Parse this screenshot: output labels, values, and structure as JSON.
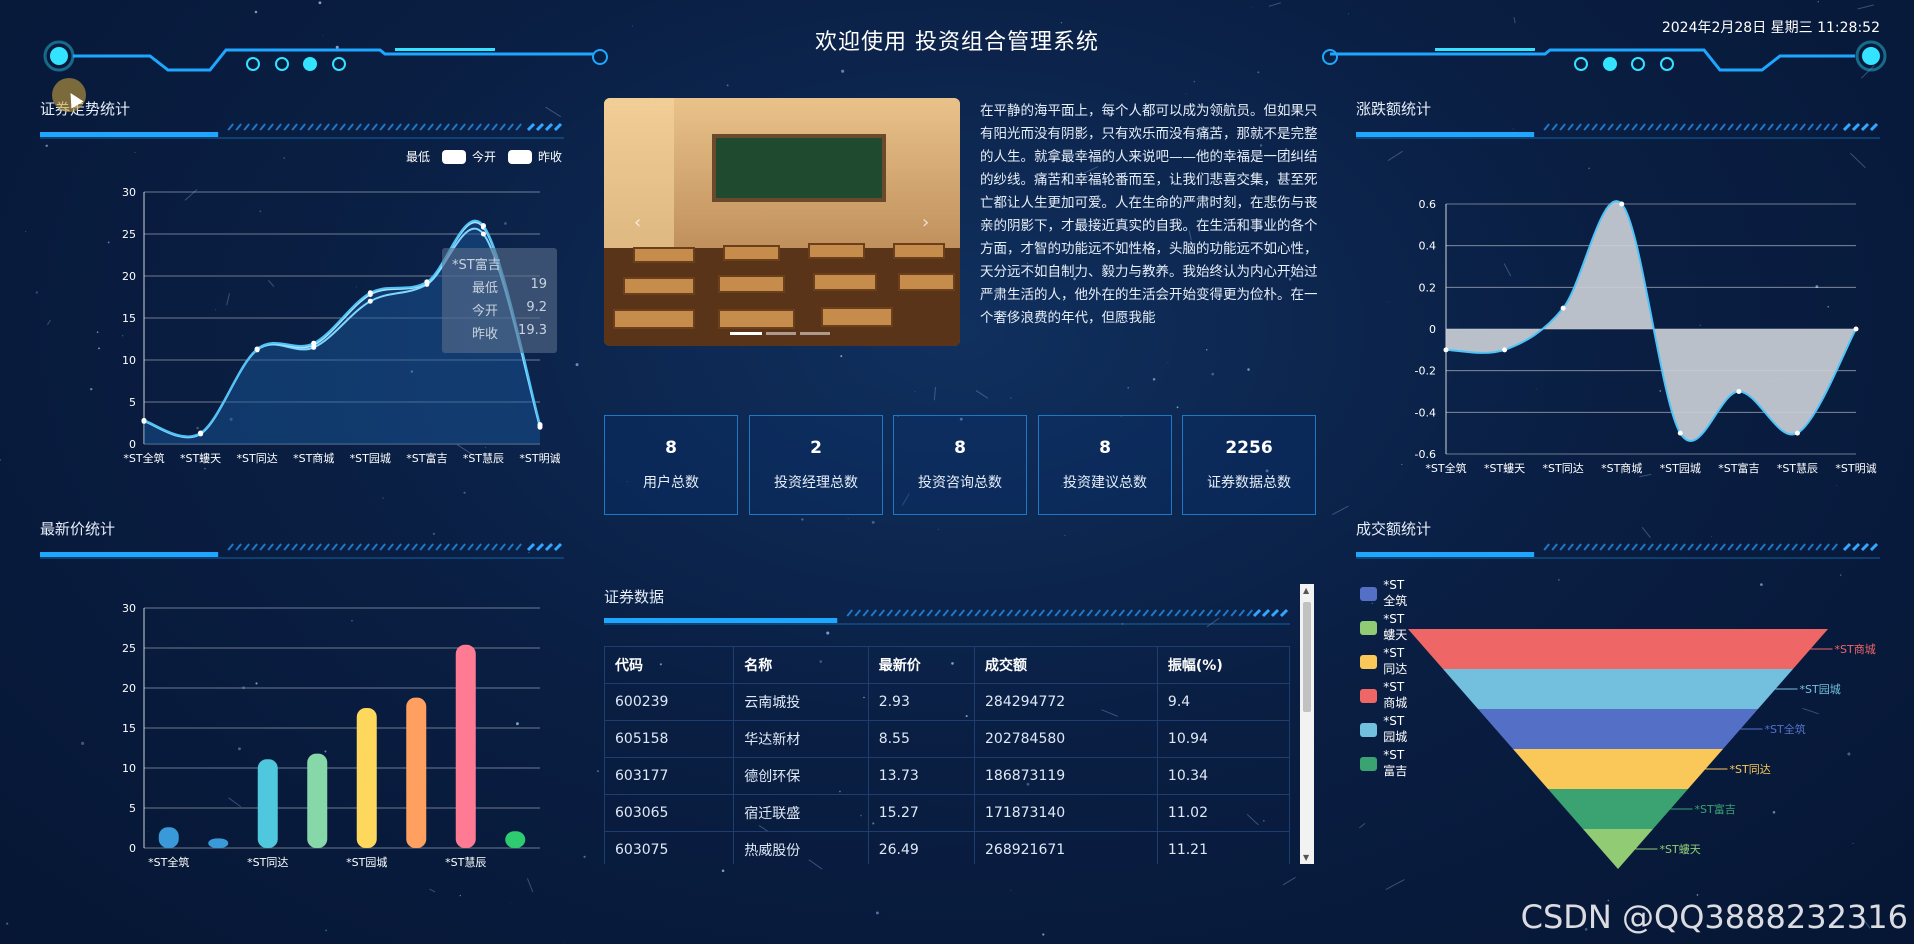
{
  "header": {
    "title": "欢迎使用 投资组合管理系统",
    "datetime": "2024年2月28日 星期三 11:28:52"
  },
  "colors": {
    "accent": "#1ea7ff",
    "cyan": "#33e3ff",
    "line": "#4fc3f7",
    "panel_border": "#1e78c8"
  },
  "trend": {
    "title": "证券走势统计",
    "legend": [
      "最低",
      "今开",
      "昨收"
    ],
    "tooltip": {
      "name": "*ST富吉",
      "rows": [
        {
          "label": "最低",
          "value": "19"
        },
        {
          "label": "今开",
          "value": "9.2"
        },
        {
          "label": "昨收",
          "value": "19.3"
        }
      ]
    }
  },
  "latest": {
    "title": "最新价统计"
  },
  "change": {
    "title": "涨跌额统计"
  },
  "volume": {
    "title": "成交额统计",
    "legend": [
      {
        "name": "*ST全筑",
        "color": "#5470c6"
      },
      {
        "name": "*ST螻天",
        "color": "#91cc75"
      },
      {
        "name": "*ST同达",
        "color": "#fac858"
      },
      {
        "name": "*ST商城",
        "color": "#ee6666"
      },
      {
        "name": "*ST园城",
        "color": "#73c0de"
      },
      {
        "name": "*ST富吉",
        "color": "#3ba272"
      }
    ],
    "labels": [
      "*ST商城",
      "*ST园城",
      "*ST全筑",
      "*ST同达",
      "*ST富吉",
      "*ST螻天"
    ]
  },
  "article": {
    "text": "在平静的海平面上，每个人都可以成为领航员。但如果只有阳光而没有阴影，只有欢乐而没有痛苦，那就不是完整的人生。就拿最幸福的人来说吧——他的幸福是一团纠结的纱线。痛苦和幸福轮番而至，让我们悲喜交集，甚至死亡都让人生更加可爱。人在生命的严肃时刻，在悲伤与丧亲的阴影下，才最接近真实的自我。在生活和事业的各个方面，才智的功能远不如性格，头脑的功能远不如心性，天分远不如自制力、毅力与教养。我始终认为内心开始过严肃生活的人，他外在的生活会开始变得更为俭朴。在一个奢侈浪费的年代，但愿我能"
  },
  "stats": [
    {
      "value": "8",
      "label": "用户总数"
    },
    {
      "value": "2",
      "label": "投资经理总数"
    },
    {
      "value": "8",
      "label": "投资咨询总数"
    },
    {
      "value": "8",
      "label": "投资建议总数"
    },
    {
      "value": "2256",
      "label": "证券数据总数"
    }
  ],
  "securities": {
    "title": "证券数据",
    "columns": [
      "代码",
      "名称",
      "最新价",
      "成交额",
      "振幅(%)"
    ],
    "rows": [
      [
        "600239",
        "云南城投",
        "2.93",
        "284294772",
        "9.4"
      ],
      [
        "605158",
        "华达新材",
        "8.55",
        "202784580",
        "10.94"
      ],
      [
        "603177",
        "德创环保",
        "13.73",
        "186873119",
        "10.34"
      ],
      [
        "603065",
        "宿迁联盛",
        "15.27",
        "171873140",
        "11.02"
      ],
      [
        "603075",
        "热威股份",
        "26.49",
        "268921671",
        "11.21"
      ]
    ]
  },
  "watermark": "CSDN @QQ3888232316",
  "chart_data": [
    {
      "type": "line",
      "title": "证券走势统计",
      "categories": [
        "*ST全筑",
        "*ST螻天",
        "*ST同达",
        "*ST商城",
        "*ST园城",
        "*ST富吉",
        "*ST慧辰",
        "*ST明诚"
      ],
      "ylim": [
        0,
        30
      ],
      "yticks": [
        0,
        5,
        10,
        15,
        20,
        25,
        30
      ],
      "series": [
        {
          "name": "最低",
          "values": [
            2.7,
            1.2,
            11.2,
            11.5,
            17.0,
            19.0,
            25.0,
            2.0
          ]
        },
        {
          "name": "今开",
          "values": [
            2.8,
            1.3,
            11.3,
            11.8,
            17.8,
            19.2,
            25.8,
            2.2
          ]
        },
        {
          "name": "昨收",
          "values": [
            2.8,
            1.3,
            11.3,
            12.0,
            18.0,
            19.3,
            26.0,
            2.3
          ]
        }
      ]
    },
    {
      "type": "bar",
      "title": "最新价统计",
      "categories": [
        "*ST全筑",
        "*ST螻天",
        "*ST同达",
        "*ST商城",
        "*ST园城",
        "*ST富吉",
        "*ST慧辰",
        "*ST明诚"
      ],
      "xtick_labels": [
        "*ST全筑",
        "",
        "*ST同达",
        "",
        "*ST园城",
        "",
        "*ST慧辰",
        ""
      ],
      "values": [
        2.6,
        1.2,
        11.1,
        11.8,
        17.5,
        18.8,
        25.4,
        2.1
      ],
      "colors": [
        "#3a9ad9",
        "#3a9ad9",
        "#4fc7dd",
        "#86d8a8",
        "#fdd85d",
        "#ffa061",
        "#ff7b93",
        "#2ecc71"
      ],
      "ylim": [
        0,
        30
      ],
      "yticks": [
        0,
        5,
        10,
        15,
        20,
        25,
        30
      ]
    },
    {
      "type": "area",
      "title": "涨跌额统计",
      "categories": [
        "*ST全筑",
        "*ST螻天",
        "*ST同达",
        "*ST商城",
        "*ST园城",
        "*ST富吉",
        "*ST慧辰",
        "*ST明诚"
      ],
      "values": [
        -0.1,
        -0.1,
        0.1,
        0.6,
        -0.5,
        -0.3,
        -0.5,
        0.0
      ],
      "ylim": [
        -0.6,
        0.6
      ],
      "yticks": [
        -0.6,
        -0.4,
        -0.2,
        0,
        0.2,
        0.4,
        0.6
      ]
    },
    {
      "type": "funnel",
      "title": "成交额统计",
      "categories": [
        "*ST商城",
        "*ST园城",
        "*ST全筑",
        "*ST同达",
        "*ST富吉",
        "*ST螻天"
      ],
      "values": [
        6,
        5,
        4,
        3,
        2,
        1
      ],
      "colors": [
        "#ee6666",
        "#73c0de",
        "#5470c6",
        "#fac858",
        "#3ba272",
        "#91cc75"
      ]
    }
  ]
}
